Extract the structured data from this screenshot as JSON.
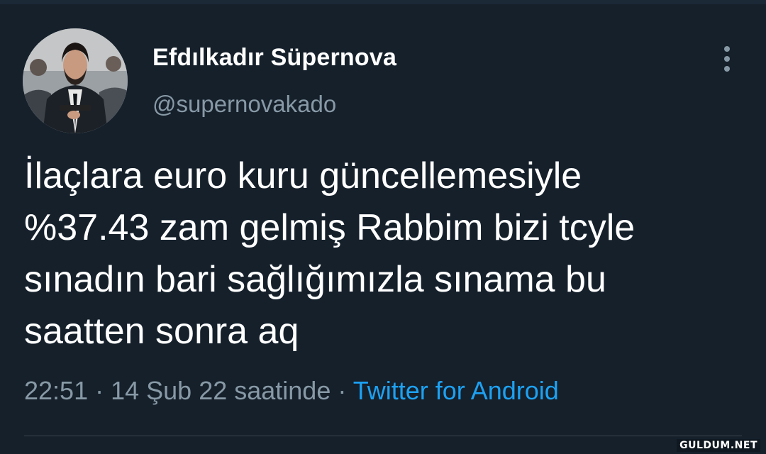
{
  "tweet": {
    "author": {
      "display_name": "Efdılkadır Süpernova",
      "handle": "@supernovakado"
    },
    "text": "İlaçlara euro kuru güncellemesiyle\n%37.43 zam gelmiş Rabbim bizi tcyle\nsınadın bari sağlığımızla sınama bu\nsaatten sonra aq",
    "time": "22:51",
    "separator": " · ",
    "date": "14 Şub 22 saatinde",
    "source": "Twitter for Android"
  },
  "watermark": "GULDUM.NET",
  "colors": {
    "background": "#15202b",
    "primary_text": "#ffffff",
    "secondary_text": "#8899a6",
    "link": "#1da1f2",
    "divider": "#38444d"
  },
  "icons": {
    "more": "vertical-ellipsis-icon"
  }
}
